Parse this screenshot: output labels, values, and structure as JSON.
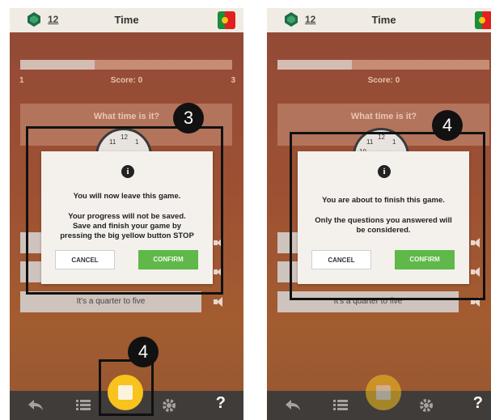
{
  "screens": [
    {
      "header": {
        "level": "12",
        "title": "Time"
      },
      "progress_fraction": 0.35,
      "score_left": "1",
      "score": "Score: 0",
      "score_right": "3",
      "question": "What time is it?",
      "clock_numbers": [
        "12",
        "11",
        "1"
      ],
      "answers": [
        "It's a quarter to five"
      ],
      "dialog": {
        "line1": "You will now leave this game.",
        "line2": "Your progress will not be saved.",
        "line3": "Save and finish your game by",
        "line4": "pressing the big yellow button STOP",
        "cancel": "CANCEL",
        "confirm": "CONFIRM"
      },
      "callouts": [
        "3",
        "4"
      ]
    },
    {
      "header": {
        "level": "12",
        "title": "Time"
      },
      "progress_fraction": 0.35,
      "score": "Score: 0",
      "question": "What time is it?",
      "clock_numbers": [
        "12",
        "11",
        "1",
        "10"
      ],
      "answers": [
        "It's a quarter to five"
      ],
      "dialog": {
        "line1": "You are about to finish this game.",
        "line2": "Only the questions you answered will",
        "line3": "be considered.",
        "cancel": "CANCEL",
        "confirm": "CONFIRM"
      },
      "callouts": [
        "4"
      ]
    }
  ],
  "bottom_bar": {
    "help": "?"
  },
  "colors": {
    "stop_button": "#f7c31c",
    "confirm": "#5fb849",
    "background": "#c0633f"
  }
}
